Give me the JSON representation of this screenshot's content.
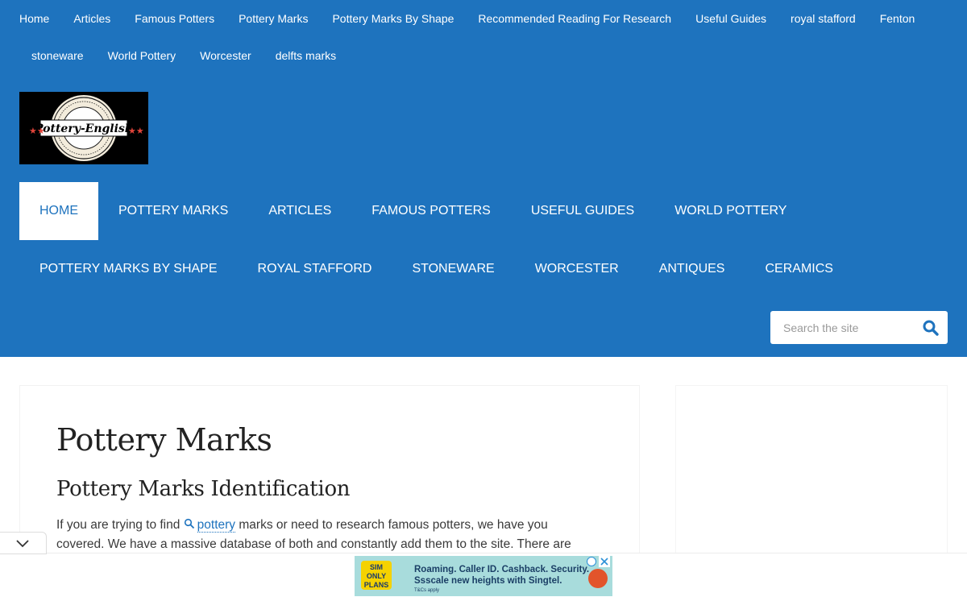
{
  "top_nav": {
    "items": [
      "Home",
      "Articles",
      "Famous Potters",
      "Pottery Marks",
      "Pottery Marks By Shape",
      "Recommended Reading For Research",
      "Useful Guides",
      "royal stafford",
      "Fenton",
      "stoneware",
      "World Pottery",
      "Worcester",
      "delfts marks"
    ]
  },
  "logo": {
    "text": "Pottery-English"
  },
  "main_nav": {
    "items": [
      "HOME",
      "POTTERY MARKS",
      "ARTICLES",
      "FAMOUS POTTERS",
      "USEFUL GUIDES",
      "WORLD POTTERY",
      "POTTERY MARKS BY SHAPE",
      "ROYAL STAFFORD",
      "STONEWARE",
      "WORCESTER",
      "ANTIQUES",
      "CERAMICS"
    ],
    "active": "HOME"
  },
  "search": {
    "placeholder": "Search the site",
    "icon": "search-icon"
  },
  "main": {
    "title": "Pottery Marks",
    "subtitle": "Pottery Marks Identification",
    "intro_before": "If you are trying to find ",
    "intro_link": "pottery",
    "intro_after": " marks or need to research famous potters, we have you covered. We have a massive database of both and constantly add them to the site. There are"
  },
  "ad": {
    "badge": "SIM ONLY PLANS",
    "line1": "Roaming. Caller ID. Cashback. Security.",
    "line2": "Ssscale new heights with Singtel.",
    "tc": "T&Cs apply"
  },
  "colors": {
    "header_bg": "#1e73be",
    "link": "#1e73be",
    "ad_bg": "#a8dcdc"
  }
}
